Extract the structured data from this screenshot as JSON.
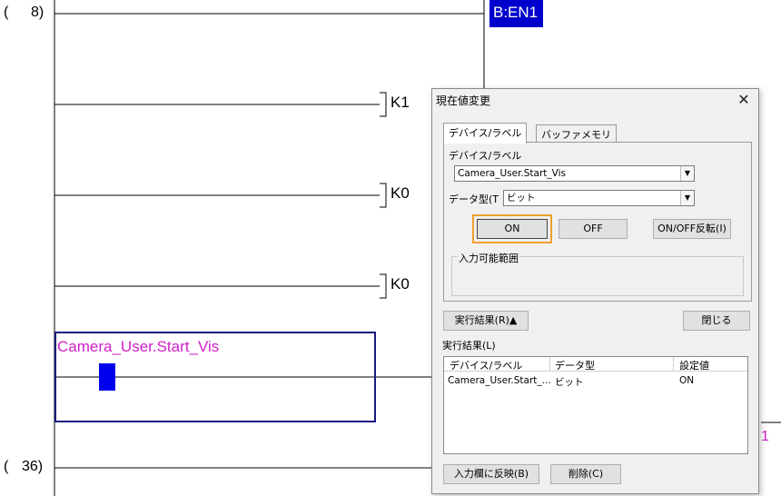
{
  "ladder": {
    "steps": [
      "(",
      "8)",
      "(",
      "36)"
    ],
    "en_label": "B:EN1",
    "contacts": [
      "K1",
      "K0",
      "K0"
    ],
    "selected_device": "Camera_User.Start_Vis",
    "right_fragment": "1"
  },
  "dialog": {
    "title": "現在値変更",
    "close_glyph": "✕",
    "tabs": [
      "デバイス/ラベル",
      "バッファメモリ"
    ],
    "device_label": "デバイス/ラベル",
    "device_value": "Camera_User.Start_Vis",
    "datatype_label": "データ型(T",
    "datatype_value": "ビット",
    "buttons": {
      "on": "ON",
      "off": "OFF",
      "toggle": "ON/OFF反転(I)"
    },
    "input_range_title": "入力可能範囲",
    "exec_result_toggle": "実行結果(R)▲",
    "close_button": "閉じる",
    "exec_result_label": "実行結果(L)",
    "result_columns": [
      "デバイス/ラベル",
      "データ型",
      "設定値"
    ],
    "result_rows": [
      [
        "Camera_User.Start_...",
        "ビット",
        "ON"
      ]
    ],
    "reflect_button": "入力欄に反映(B)",
    "delete_button": "削除(C)"
  }
}
